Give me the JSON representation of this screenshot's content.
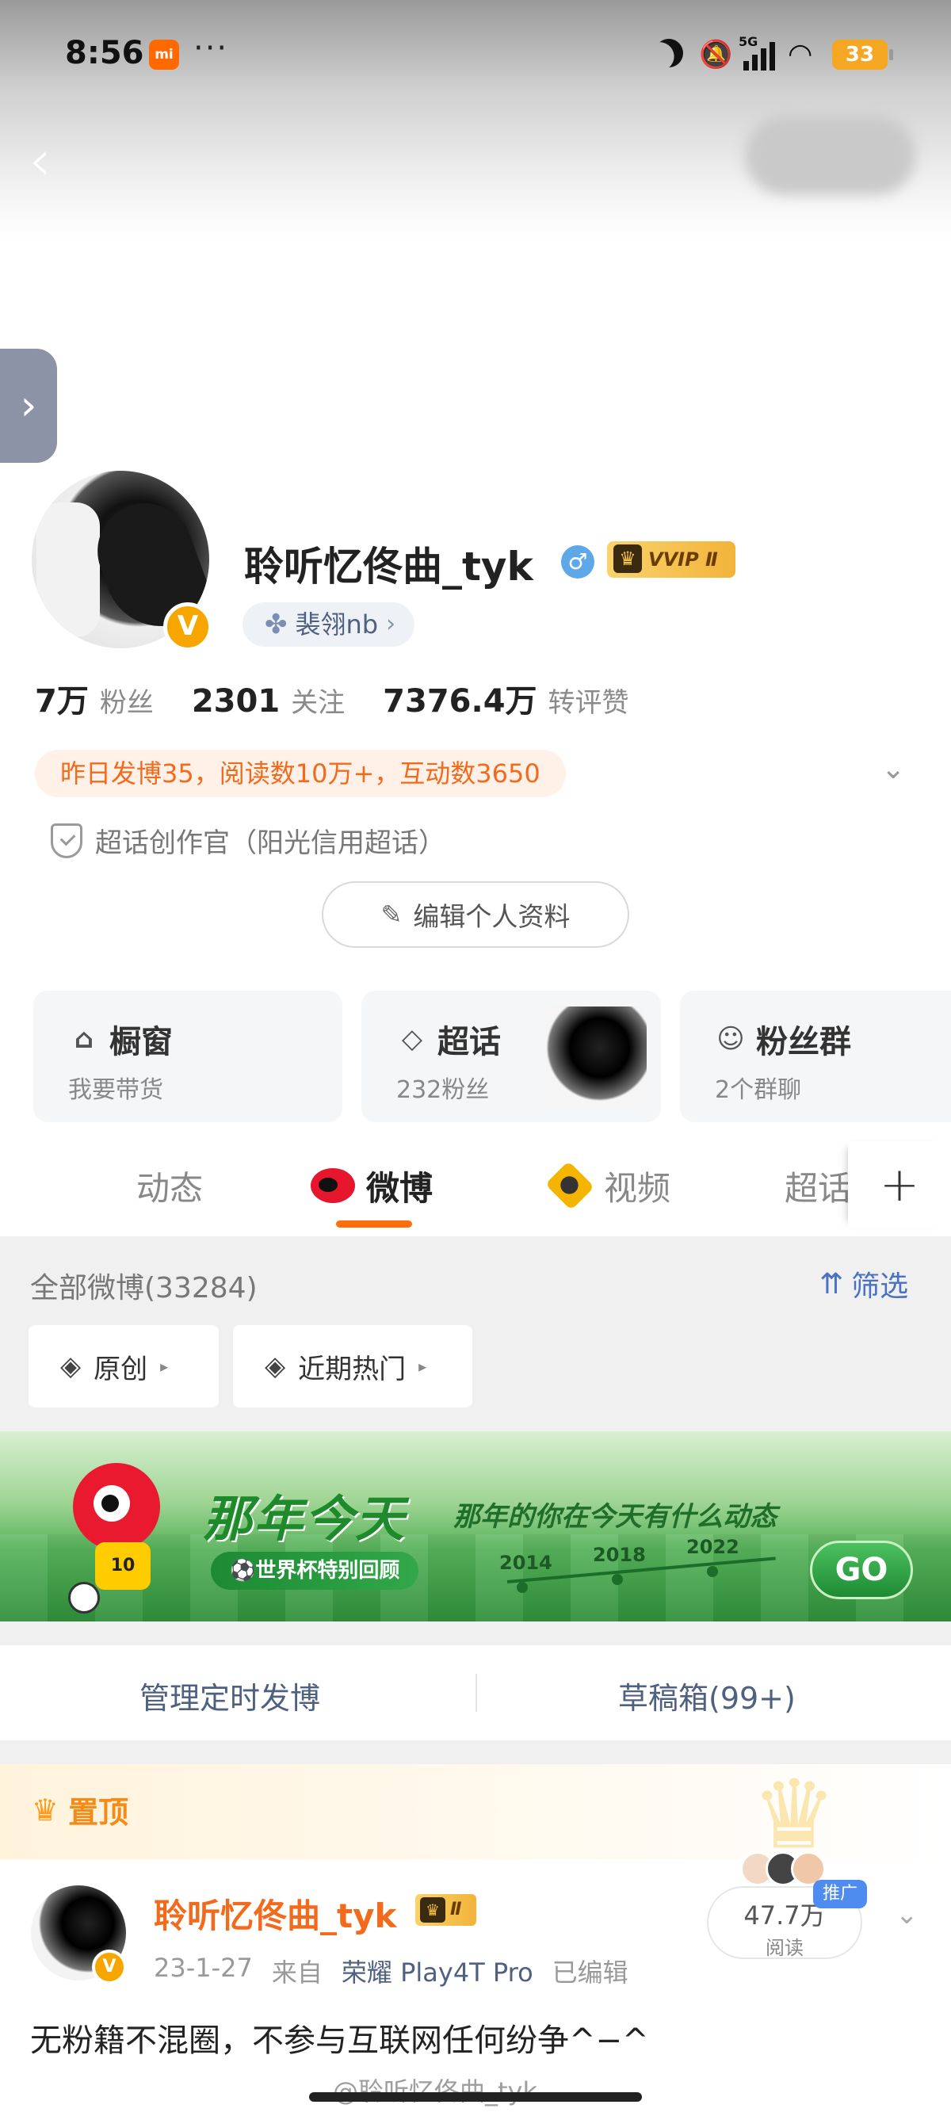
{
  "status_bar": {
    "time": "8:56",
    "app_icon_label": "mi",
    "more": "···",
    "network": "5G",
    "battery": "33"
  },
  "profile": {
    "name": "聆听忆佟曲_tyk",
    "vip_badge": "VVIP Ⅱ",
    "group_chip": "裴翎nb",
    "stats": [
      {
        "num": "7万",
        "label": "粉丝"
      },
      {
        "num": "2301",
        "label": "关注"
      },
      {
        "num": "7376.4万",
        "label": "转评赞"
      }
    ],
    "highlight": "昨日发博35，阅读数10万+，互动数3650",
    "super_creator": "超话创作官（阳光信用超话）",
    "edit_profile": "编辑个人资料"
  },
  "cards": {
    "shop": {
      "title": "橱窗",
      "sub": "我要带货"
    },
    "topic": {
      "title": "超话",
      "sub": "232粉丝"
    },
    "fans": {
      "title": "粉丝群",
      "sub": "2个群聊"
    }
  },
  "tabs": {
    "dynamic": "动态",
    "weibo": "微博",
    "video": "视频",
    "super": "超话",
    "plus": "+"
  },
  "feed": {
    "all_weibo": "全部微博(33284)",
    "filter": "筛选",
    "sub_filters": {
      "original": "原创",
      "hot": "近期热门"
    }
  },
  "banner": {
    "title": "那年今天",
    "slogan": "那年的你在今天有什么动态",
    "pill": "⚽世界杯特别回顾",
    "years": [
      "2014",
      "2018",
      "2022"
    ],
    "go": "GO",
    "mascot_number": "10"
  },
  "manage": {
    "scheduled": "管理定时发博",
    "drafts": "草稿箱(99+)"
  },
  "post": {
    "pin_label": "置顶",
    "author": "聆听忆佟曲_tyk",
    "vip": "Ⅱ",
    "date": "23-1-27",
    "from_label": "来自",
    "source": "荣耀 Play4T Pro",
    "edited": "已编辑",
    "read_count": "47.7万",
    "read_label": "阅读",
    "promo": "推广",
    "text": "无粉籍不混圈，不参与互联网任何纷争^−^"
  },
  "watermark": "@聆听忆佟曲_tyk",
  "colors": {
    "accent_orange": "#ff6e0d",
    "link_blue": "#4f6180",
    "weibo_red": "#e6162d",
    "vip_gold": "#f2b33a"
  },
  "icons": [
    "back-arrow-icon",
    "moon-icon",
    "mute-icon",
    "signal-icon",
    "wifi-icon",
    "gender-male-icon",
    "clover-icon",
    "shield-icon",
    "pencil-icon",
    "bag-icon",
    "diamond-icon",
    "people-icon",
    "weibo-logo-icon",
    "video-icon",
    "plus-icon",
    "filter-icon",
    "layers-icon",
    "crown-icon",
    "chevron-down-icon"
  ]
}
